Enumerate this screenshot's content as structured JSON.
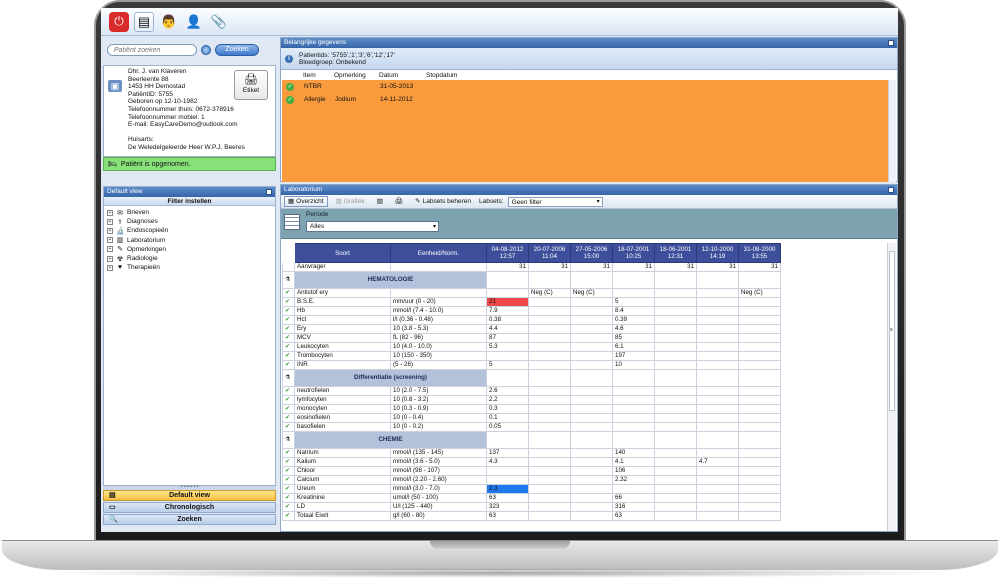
{
  "search": {
    "placeholder": "Patiënt zoeken",
    "button": "Zoeken"
  },
  "patient": {
    "lines": [
      "Dhr. J. van Klaveren",
      "Beerleente 88",
      "1453 HH Demostad",
      "PatiëntID: 5755",
      "Geboren op 12-10-1982",
      "Telefoonnummer thuis: 0672-378916",
      "Telefoonnummer mobiel: 1",
      "E-mail: EasyCareDemo@outlook.com",
      "",
      "Huisarts:",
      "De Weledelgeleerde Heer W.P.J. Beeres"
    ],
    "etiket_label": "Etiket",
    "status": "Patiënt is opgenomen."
  },
  "default_view": {
    "title": "Default view",
    "filter_label": "Filter instellen",
    "items": [
      "Brieven",
      "Diagnoses",
      "Endoscopieën",
      "Laboratorium",
      "Opmerkingen",
      "Radiologie",
      "Therapieën"
    ]
  },
  "nav": {
    "default_view": "Default view",
    "chronologisch": "Chronologisch",
    "zoeken": "Zoeken"
  },
  "important": {
    "title": "Belangrijke gegevens",
    "patientids": "Patientids: '5755','1','3','6','12','17'",
    "bloedgroep": "Bloedgroep: Onbekend",
    "columns": {
      "item": "Item",
      "opmerking": "Opmerking",
      "datum": "Datum",
      "stopdatum": "Stopdatum"
    },
    "rows": [
      {
        "item": "NTBR",
        "opmerking": "",
        "datum": "31-05-2013",
        "stopdatum": ""
      },
      {
        "item": "Allergie",
        "opmerking": "Jodium",
        "datum": "14-11-2012",
        "stopdatum": ""
      }
    ]
  },
  "lab": {
    "title": "Laboratorium",
    "toolbar": {
      "overzicht": "Overzicht",
      "grafiek": "Grafiek",
      "labsets_beheren": "Labsets beheren",
      "labsets_label": "Labsets:",
      "labsets_value": "Geen filter"
    },
    "periode_label": "Periode",
    "periode_value": "Alles",
    "headers": {
      "soort": "Soort",
      "eenheid": "Eenheid/Norm."
    },
    "dates": [
      {
        "date": "04-08-2012",
        "time": "12:57"
      },
      {
        "date": "20-07-2006",
        "time": "11:04"
      },
      {
        "date": "27-05-2006",
        "time": "15:00"
      },
      {
        "date": "18-07-2001",
        "time": "10:25"
      },
      {
        "date": "18-06-2001",
        "time": "12:31"
      },
      {
        "date": "12-10-2000",
        "time": "14:19"
      },
      {
        "date": "31-08-2000",
        "time": "13:55"
      }
    ],
    "aanvrager": {
      "label": "Aanvrager",
      "values": [
        "31",
        "31",
        "31",
        "31",
        "31",
        "31",
        "31"
      ]
    },
    "sections": [
      {
        "title": "HEMATOLOGIE",
        "rows": [
          {
            "name": "Antistof ery",
            "unit": "",
            "values": [
              "",
              "Neg (C)",
              "Neg (C)",
              "",
              "",
              "",
              "Neg (C)"
            ]
          },
          {
            "name": "B.S.E.",
            "unit": "mm/uur (0 - 20)",
            "values": [
              "21",
              "",
              "",
              "5",
              "",
              "",
              ""
            ],
            "hl": [
              0
            ]
          },
          {
            "name": "Hb",
            "unit": "mmol/l (7.4 - 10.0)",
            "values": [
              "7.9",
              "",
              "",
              "8.4",
              "",
              "",
              ""
            ]
          },
          {
            "name": "Hct",
            "unit": "l/l (0.36 - 0.48)",
            "values": [
              "0.38",
              "",
              "",
              "0.39",
              "",
              "",
              ""
            ]
          },
          {
            "name": "Ery",
            "unit": "10 (3.8 - 5.3)",
            "values": [
              "4.4",
              "",
              "",
              "4.6",
              "",
              "",
              ""
            ]
          },
          {
            "name": "MCV",
            "unit": "fL (82 - 96)",
            "values": [
              "87",
              "",
              "",
              "85",
              "",
              "",
              ""
            ]
          },
          {
            "name": "Leukocyten",
            "unit": "10 (4.0 - 10.0)",
            "values": [
              "5.3",
              "",
              "",
              "6.1",
              "",
              "",
              ""
            ]
          },
          {
            "name": "Trombocyten",
            "unit": "10 (150 - 350)",
            "values": [
              "",
              "",
              "",
              "197",
              "",
              "",
              ""
            ]
          },
          {
            "name": "INR",
            "unit": "(5 - 26)",
            "values": [
              "5",
              "",
              "",
              "10",
              "",
              "",
              ""
            ]
          }
        ]
      },
      {
        "title": "Differentiatie (screening)",
        "rows": [
          {
            "name": "neutrofielen",
            "unit": "10 (2.0 - 7.5)",
            "values": [
              "2.6",
              "",
              "",
              "",
              "",
              "",
              ""
            ]
          },
          {
            "name": "lymfocyten",
            "unit": "10 (0.8 - 3.2)",
            "values": [
              "2.2",
              "",
              "",
              "",
              "",
              "",
              ""
            ]
          },
          {
            "name": "monocyten",
            "unit": "10 (0.3 - 0.9)",
            "values": [
              "0.3",
              "",
              "",
              "",
              "",
              "",
              ""
            ]
          },
          {
            "name": "eosinofielen",
            "unit": "10 (0 - 0.4)",
            "values": [
              "0.1",
              "",
              "",
              "",
              "",
              "",
              ""
            ]
          },
          {
            "name": "basofielen",
            "unit": "10 (0 - 0.2)",
            "values": [
              "0.05",
              "",
              "",
              "",
              "",
              "",
              ""
            ]
          }
        ]
      },
      {
        "title": "CHEMIE",
        "rows": [
          {
            "name": "Natrium",
            "unit": "mmol/l (135 - 145)",
            "values": [
              "137",
              "",
              "",
              "140",
              "",
              "",
              ""
            ]
          },
          {
            "name": "Kalium",
            "unit": "mmol/l (3.6 - 5.0)",
            "values": [
              "4.3",
              "",
              "",
              "4.1",
              "",
              "4.7",
              ""
            ]
          },
          {
            "name": "Chloor",
            "unit": "mmol/l (98 - 107)",
            "values": [
              "",
              "",
              "",
              "106",
              "",
              "",
              ""
            ]
          },
          {
            "name": "Calcium",
            "unit": "mmol/l (2.20 - 2.60)",
            "values": [
              "",
              "",
              "",
              "2.32",
              "",
              "",
              ""
            ]
          },
          {
            "name": "Ureum",
            "unit": "mmol/l (3.0 - 7.0)",
            "values": [
              "2.3",
              "",
              "",
              "",
              "",
              "",
              ""
            ],
            "hl_blue": [
              0
            ]
          },
          {
            "name": "Kreatinine",
            "unit": "umol/l (50 - 100)",
            "values": [
              "63",
              "",
              "",
              "66",
              "",
              "",
              ""
            ]
          },
          {
            "name": "LD",
            "unit": "U/l (125 - 440)",
            "values": [
              "323",
              "",
              "",
              "316",
              "",
              "",
              ""
            ]
          },
          {
            "name": "Totaal Eiwit",
            "unit": "g/l (60 - 80)",
            "values": [
              "63",
              "",
              "",
              "63",
              "",
              "",
              ""
            ]
          }
        ]
      }
    ]
  }
}
